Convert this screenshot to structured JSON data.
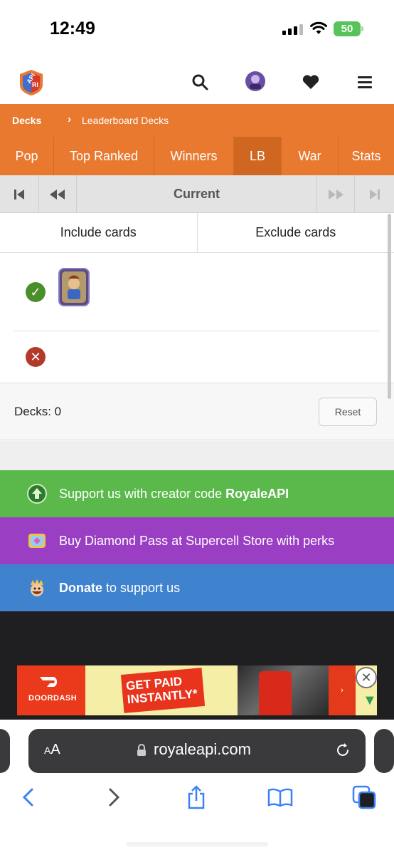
{
  "status_bar": {
    "time": "12:49",
    "battery": "50"
  },
  "header": {
    "logo_text_top": "API",
    "logo_text_bottom": "RI",
    "icons": [
      "search-icon",
      "avatar-icon",
      "heart-icon",
      "menu-icon"
    ]
  },
  "breadcrumb": {
    "root": "Decks",
    "separator": "›",
    "current": "Leaderboard Decks"
  },
  "tabs": [
    {
      "label": "Pop",
      "active": false
    },
    {
      "label": "Top Ranked",
      "active": false
    },
    {
      "label": "Winners",
      "active": false
    },
    {
      "label": "LB",
      "active": true
    },
    {
      "label": "War",
      "active": false
    },
    {
      "label": "Stats",
      "active": false
    }
  ],
  "pager": {
    "current_label": "Current"
  },
  "filters": {
    "include_label": "Include cards",
    "exclude_label": "Exclude cards"
  },
  "deck_summary": {
    "label": "Decks: 0",
    "reset_label": "Reset"
  },
  "banners": [
    {
      "prefix": "Support us with creator code ",
      "bold": "RoyaleAPI",
      "suffix": "",
      "color": "#5bb94c"
    },
    {
      "prefix": "Buy Diamond Pass at Supercell Store with perks",
      "bold": "",
      "suffix": "",
      "color": "#9a3fc4"
    },
    {
      "prefix": "",
      "bold": "Donate",
      "suffix": " to support us",
      "color": "#3f83cf"
    }
  ],
  "ad": {
    "brand": "DOORDASH",
    "headline": "GET PAID INSTANTLY*"
  },
  "browser": {
    "aa_label": "AA",
    "url": "royaleapi.com"
  },
  "colors": {
    "accent": "#e8792f",
    "include": "#4a8f2a",
    "exclude": "#b33a2a"
  }
}
